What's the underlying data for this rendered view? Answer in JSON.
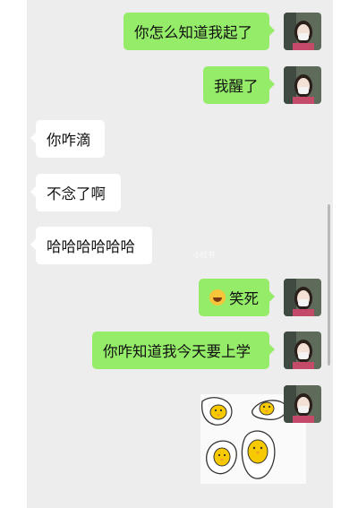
{
  "messages": [
    {
      "direction": "out",
      "text": "你怎么知道我起了",
      "avatar": "user-avatar"
    },
    {
      "direction": "out",
      "text": "我醒了",
      "avatar": "user-avatar"
    },
    {
      "direction": "in",
      "text": "你咋滴"
    },
    {
      "direction": "in",
      "text": "不念了啊"
    },
    {
      "direction": "in",
      "text": "哈哈哈哈哈哈"
    },
    {
      "direction": "out",
      "text": "笑死",
      "emoji": "laughing-tears-emoji",
      "avatar": "user-avatar"
    },
    {
      "direction": "out",
      "text": "你咋知道我今天要上学",
      "avatar": "user-avatar"
    },
    {
      "direction": "out",
      "type": "sticker",
      "sticker": "egg-yolk-ducks-sticker",
      "avatar": "user-avatar"
    }
  ],
  "watermark": "小红书",
  "colors": {
    "outgoing_bubble": "#95ec69",
    "incoming_bubble": "#ffffff",
    "background": "#ededed"
  }
}
